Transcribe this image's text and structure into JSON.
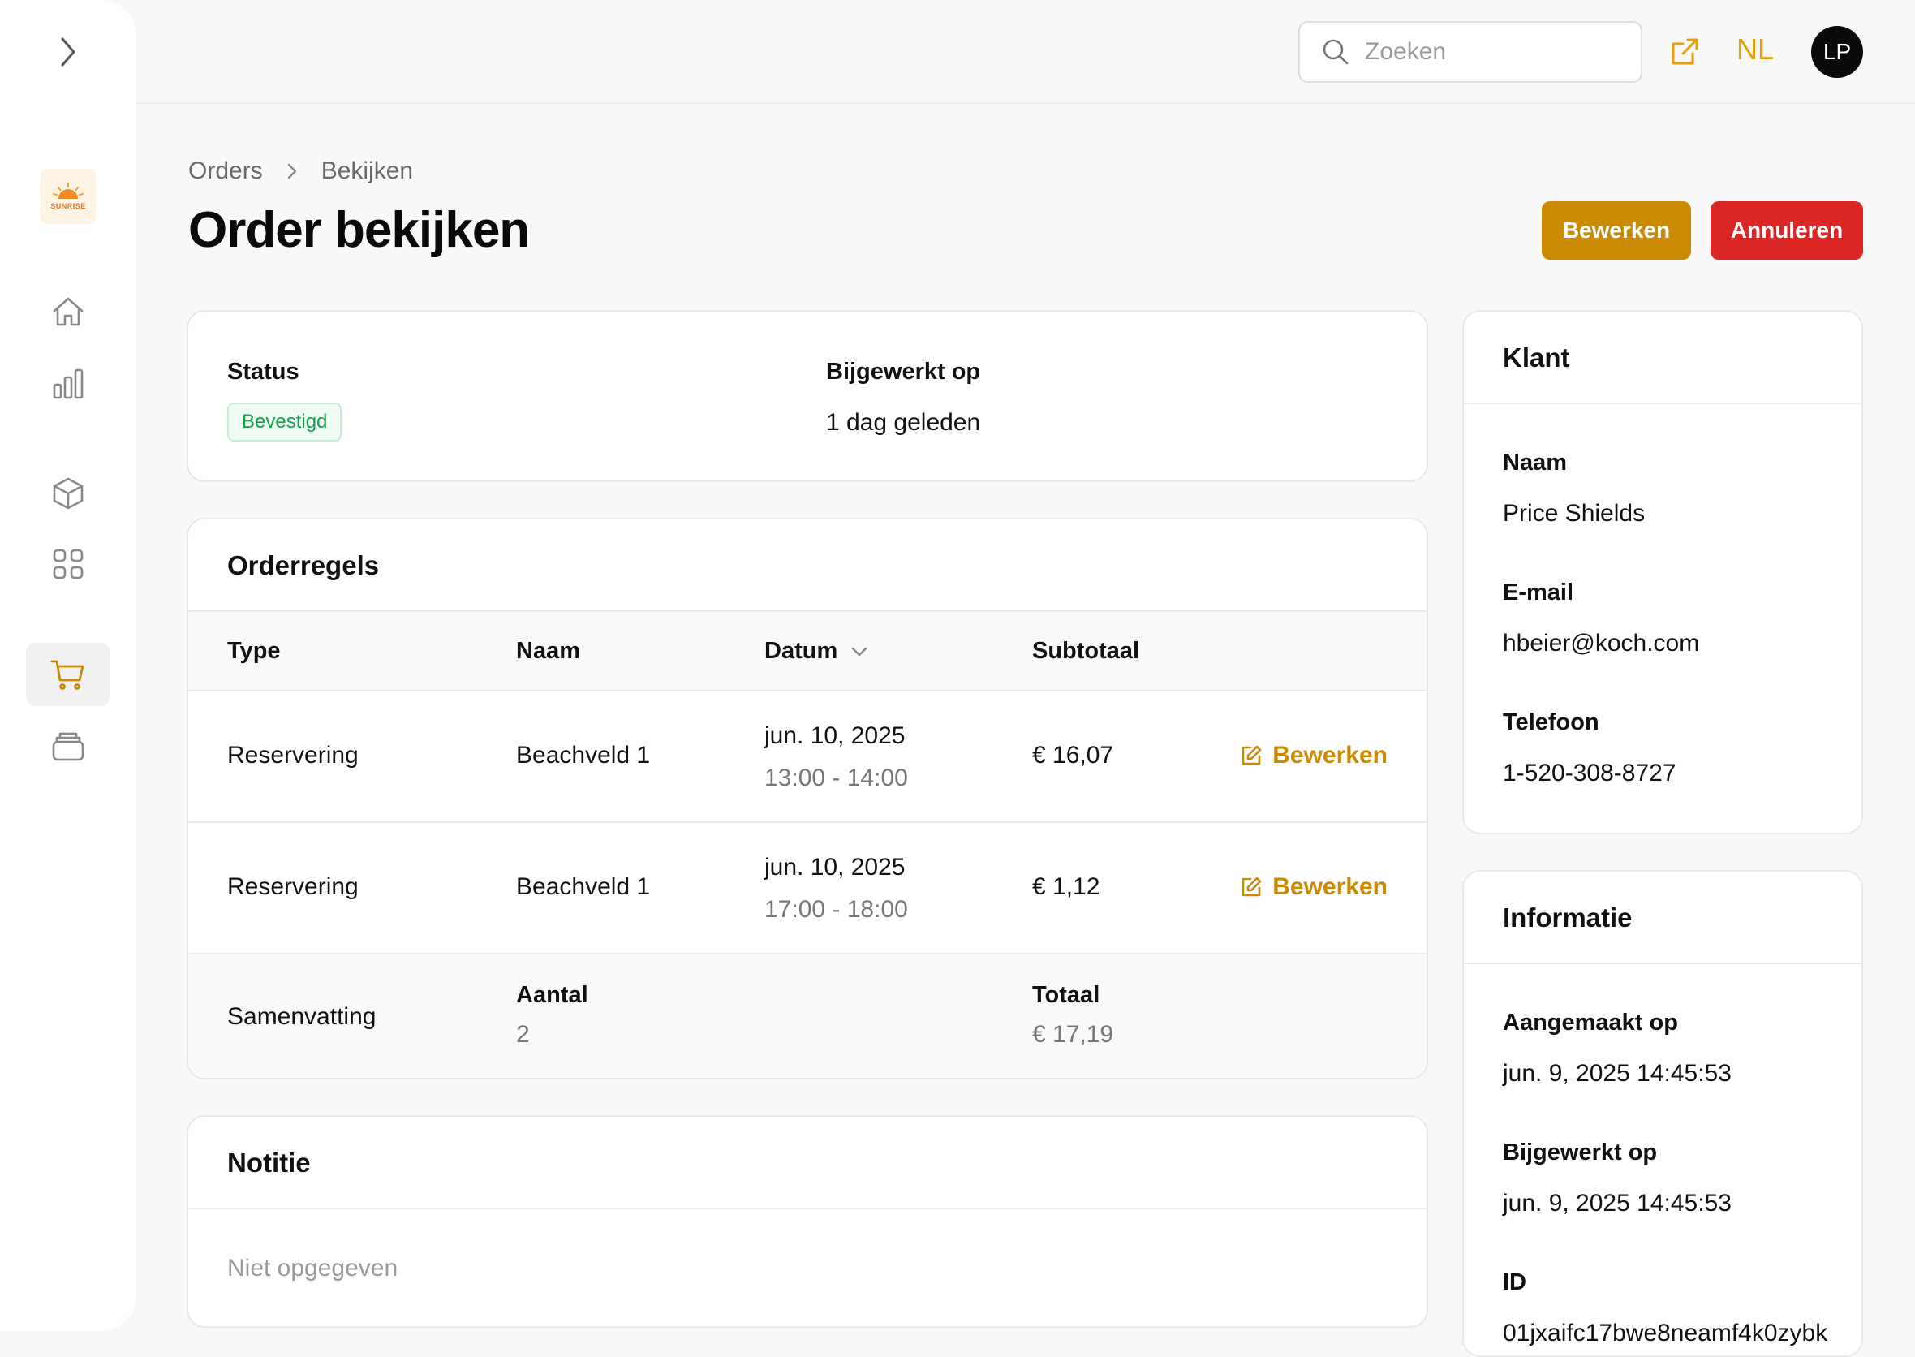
{
  "sidebar": {
    "logo_text": "SUNRISE",
    "nav": [
      {
        "icon": "home-icon"
      },
      {
        "icon": "bar-chart-icon"
      },
      {
        "icon": "cube-icon"
      },
      {
        "icon": "grid-icon"
      },
      {
        "icon": "cart-icon",
        "active": true
      },
      {
        "icon": "stack-icon"
      }
    ]
  },
  "topbar": {
    "search_placeholder": "Zoeken",
    "language": "NL",
    "avatar_initials": "LP"
  },
  "breadcrumb": [
    "Orders",
    "Bekijken"
  ],
  "page_title": "Order bekijken",
  "actions": {
    "edit": "Bewerken",
    "cancel": "Annuleren"
  },
  "status_card": {
    "status_label": "Status",
    "status_value": "Bevestigd",
    "updated_label": "Bijgewerkt op",
    "updated_value": "1 dag geleden"
  },
  "order_lines": {
    "title": "Orderregels",
    "columns": [
      "Type",
      "Naam",
      "Datum",
      "Subtotaal"
    ],
    "rows": [
      {
        "type": "Reservering",
        "name": "Beachveld 1",
        "date": "jun. 10, 2025",
        "time": "13:00 - 14:00",
        "subtotal": "€ 16,07",
        "action": "Bewerken"
      },
      {
        "type": "Reservering",
        "name": "Beachveld 1",
        "date": "jun. 10, 2025",
        "time": "17:00 - 18:00",
        "subtotal": "€ 1,12",
        "action": "Bewerken"
      }
    ],
    "summary": {
      "label": "Samenvatting",
      "count_label": "Aantal",
      "count_value": "2",
      "total_label": "Totaal",
      "total_value": "€ 17,19"
    }
  },
  "note": {
    "title": "Notitie",
    "value": "Niet opgegeven"
  },
  "customer": {
    "title": "Klant",
    "name_label": "Naam",
    "name_value": "Price Shields",
    "email_label": "E-mail",
    "email_value": "hbeier@koch.com",
    "phone_label": "Telefoon",
    "phone_value": "1-520-308-8727"
  },
  "info": {
    "title": "Informatie",
    "created_label": "Aangemaakt op",
    "created_value": "jun. 9, 2025 14:45:53",
    "updated_label": "Bijgewerkt op",
    "updated_value": "jun. 9, 2025 14:45:53",
    "id_label": "ID",
    "id_value": "01jxaifc17bwe8neamf4k0zybk"
  },
  "colors": {
    "accent": "#ca8a04",
    "danger": "#dc2626",
    "success": "#16a34a"
  }
}
